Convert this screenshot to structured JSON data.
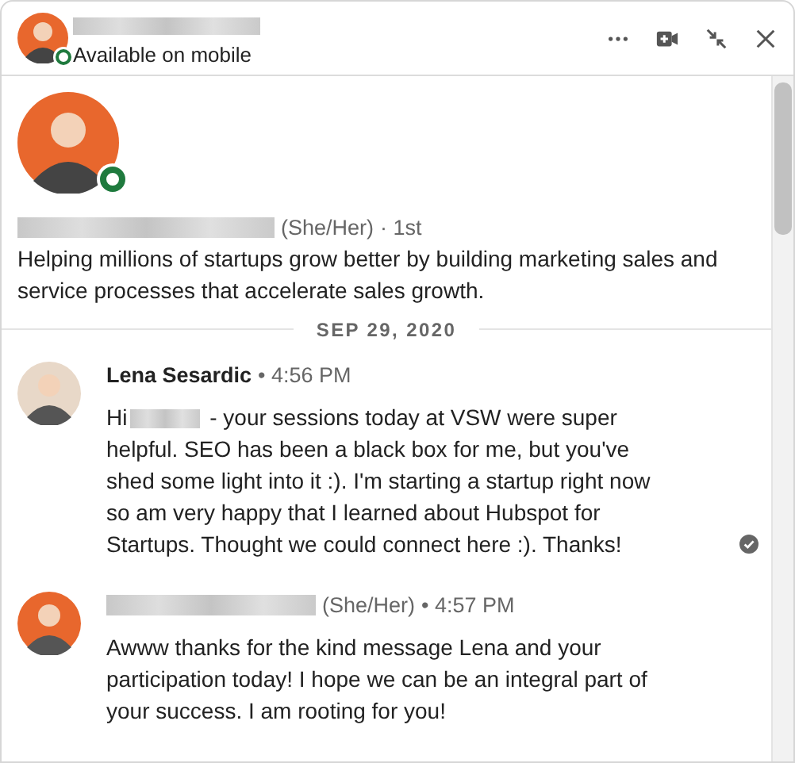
{
  "header": {
    "status": "Available on mobile",
    "online": true
  },
  "profile": {
    "online": true,
    "pronouns": "(She/Her)",
    "degree": "· 1st",
    "headline": "Helping millions of startups grow better by building marketing sales and service processes that accelerate sales growth."
  },
  "date": "SEP 29, 2020",
  "messages": [
    {
      "kind": "named",
      "sender": "Lena Sesardic",
      "time": "• 4:56 PM",
      "before": "Hi",
      "after": " - your sessions today at VSW were super helpful. SEO has been a black box for me, but you've shed some light into it :). I'm starting a startup right now so am very happy that I learned about Hubspot for Startups. Thought we could connect here :). Thanks!",
      "read": true
    },
    {
      "kind": "redacted",
      "pronouns": "(She/Her)",
      "time": "• 4:57 PM",
      "text": "Awww thanks for the kind message Lena and your participation today! I hope we can be an integral part of your success.  I am rooting for you!",
      "read": false
    }
  ]
}
